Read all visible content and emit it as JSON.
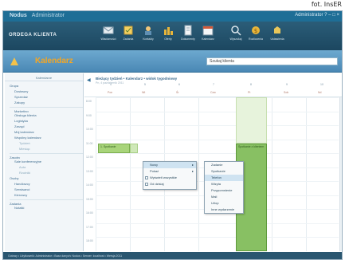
{
  "credit": "fot. InsER",
  "window": {
    "title": "Nodus",
    "title_suffix": "Administrator",
    "controls": "Administrator ? – □ ×"
  },
  "ribbon": {
    "app_name": "ORDEGA KLIENTA",
    "tools": [
      {
        "label": "Wiadomości",
        "icon": "mail-icon"
      },
      {
        "label": "Zadania",
        "icon": "tasks-icon"
      },
      {
        "label": "Kontakty",
        "icon": "contacts-icon"
      },
      {
        "label": "Oferty",
        "icon": "offers-icon"
      },
      {
        "label": "Dokumenty",
        "icon": "documents-icon"
      },
      {
        "label": "Kalendarz",
        "icon": "calendar-icon"
      },
      {
        "label": "Wyszukaj",
        "icon": "search-icon"
      },
      {
        "label": "Rozliczenia",
        "icon": "billing-icon"
      },
      {
        "label": "Ustawienia",
        "icon": "settings-icon"
      }
    ]
  },
  "section": {
    "title": "Kalendarz",
    "search_placeholder": "Szukaj klienta"
  },
  "sidebar": {
    "header": "Kalendarze",
    "items": [
      {
        "label": "Grupa",
        "level": 1
      },
      {
        "label": "Dostawcy",
        "level": 2
      },
      {
        "label": "Sprzedaż",
        "level": 2
      },
      {
        "label": "Zakupy",
        "level": 2
      },
      {
        "label": "Marketing",
        "level": 2,
        "sep": true
      },
      {
        "label": "Obsługa klienta",
        "level": 2
      },
      {
        "label": "Logistyka",
        "level": 2
      },
      {
        "label": "Zarząd",
        "level": 2
      },
      {
        "label": "Mój kalendarz",
        "level": 2
      },
      {
        "label": "Wspólny kalendarz",
        "level": 2
      },
      {
        "label": "Tydzień",
        "level": 3
      },
      {
        "label": "Miesiąc",
        "level": 3
      },
      {
        "label": "Zasoby",
        "level": 1,
        "sep": true
      },
      {
        "label": "Sale konferencyjne",
        "level": 2
      },
      {
        "label": "Auta",
        "level": 3
      },
      {
        "label": "Rzutniki",
        "level": 3
      },
      {
        "label": "Osoby",
        "level": 1
      },
      {
        "label": "Handlowcy",
        "level": 2
      },
      {
        "label": "Serwisanci",
        "level": 2
      },
      {
        "label": "Kierowcy",
        "level": 2
      },
      {
        "label": "Zadania",
        "level": 1,
        "sep": true
      },
      {
        "label": "Notatki",
        "level": 2
      }
    ]
  },
  "calendar": {
    "nav": "◀",
    "date_title": "Bieżący tydzień • Kalendarz • widok tygodniowy",
    "date_sub": "Pn, 4 październik 2011",
    "days": [
      {
        "date": "4",
        "name": "Pon"
      },
      {
        "date": "5",
        "name": "Wt"
      },
      {
        "date": "6",
        "name": "Śr"
      },
      {
        "date": "7",
        "name": "Czw"
      },
      {
        "date": "8",
        "name": "Pt"
      },
      {
        "date": "9",
        "name": "Sob"
      },
      {
        "date": "10",
        "name": "Nd"
      }
    ],
    "times": [
      "8:00",
      "9:00",
      "10:00",
      "11:00",
      "12:00",
      "13:00",
      "14:00",
      "15:00",
      "16:00",
      "17:00",
      "18:00"
    ],
    "events": [
      {
        "label": "1. Spotkanie",
        "style": "g1"
      },
      {
        "label": "Spotkanie z klientem",
        "style": "g3"
      }
    ]
  },
  "context_menu": {
    "items": [
      {
        "label": "Nowy",
        "arrow": true
      },
      {
        "label": "Pokaż",
        "arrow": true
      },
      {
        "label": "Wyświetl wszystkie",
        "checkbox": true
      },
      {
        "label": "Od dzisiaj",
        "checkbox": true
      }
    ],
    "submenu": [
      "Zadanie",
      "Spotkanie",
      "Telefon",
      "Wizyta",
      "Przypomnienie",
      "Mail",
      "Urlop",
      "Inne wydarzenie"
    ]
  },
  "statusbar": {
    "text": "Gotowy • Użytkownik: Administrator • Baza danych: Nodus • Serwer: localhost • Wersja 2011"
  }
}
